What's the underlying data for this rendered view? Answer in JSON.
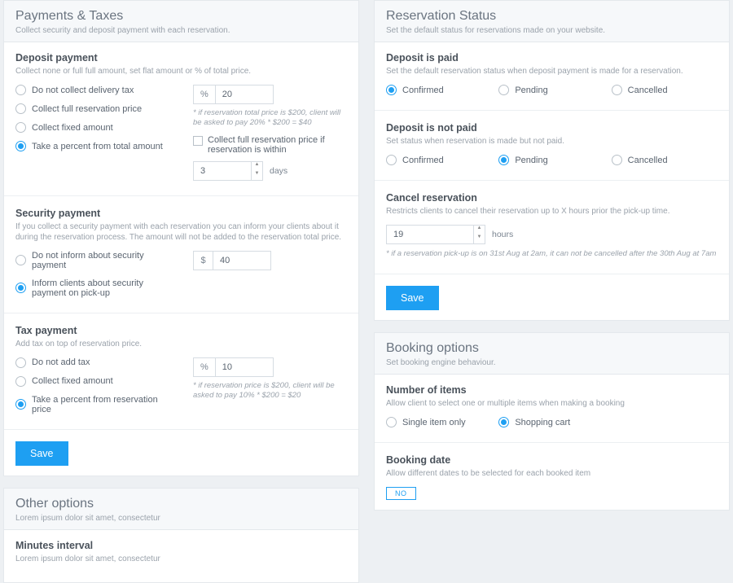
{
  "payments": {
    "title": "Payments & Taxes",
    "subtitle": "Collect security and deposit payment with each reservation.",
    "deposit": {
      "heading": "Deposit payment",
      "sub": "Collect none or full full amount, set flat amount or % of total price.",
      "opts": [
        "Do not collect delivery tax",
        "Collect full reservation price",
        "Collect fixed amount",
        "Take a percent from total amount"
      ],
      "unit": "%",
      "value": "20",
      "hint": "* if reservation total price is $200, client will be asked to pay 20% * $200 = $40",
      "chk": "Collect full reservation price if reservation is within",
      "days_value": "3",
      "days_label": "days"
    },
    "security": {
      "heading": "Security payment",
      "sub": "If you collect a security payment with each reservation you can inform your clients about it during the reservation process. The amount will not be added to the reservation total price.",
      "opts": [
        "Do not inform about security payment",
        "Inform clients about security payment on pick-up"
      ],
      "unit": "$",
      "value": "40"
    },
    "tax": {
      "heading": "Tax payment",
      "sub": "Add tax on top of reservation price.",
      "opts": [
        "Do not add tax",
        "Collect fixed amount",
        "Take a percent from reservation price"
      ],
      "unit": "%",
      "value": "10",
      "hint": "* if reservation price is $200, client will be asked to pay 10% * $200 = $20"
    },
    "save": "Save"
  },
  "other": {
    "title": "Other options",
    "subtitle": "Lorem ipsum dolor sit amet, consectetur",
    "minutes": {
      "heading": "Minutes interval",
      "sub": "Lorem ipsum dolor sit amet, consectetur"
    }
  },
  "status": {
    "title": "Reservation Status",
    "subtitle": "Set the default status for reservations made on your website.",
    "paid": {
      "heading": "Deposit is paid",
      "sub": "Set the default reservation status when deposit payment is made for a reservation."
    },
    "notpaid": {
      "heading": "Deposit is not paid",
      "sub": "Set status when reservation is made but not paid."
    },
    "opts": [
      "Confirmed",
      "Pending",
      "Cancelled"
    ],
    "cancel": {
      "heading": "Cancel reservation",
      "sub": "Restricts clients to cancel their reservation up to X hours prior the pick-up time.",
      "value": "19",
      "unit": "hours",
      "hint": "* if a reservation pick-up is on 31st Aug at 2am, it can not be cancelled after the 30th Aug at 7am"
    },
    "save": "Save"
  },
  "booking": {
    "title": "Booking options",
    "subtitle": "Set booking engine behaviour.",
    "items": {
      "heading": "Number of items",
      "sub": "Allow client to select one or multiple items when making a booking",
      "opts": [
        "Single item only",
        "Shopping cart"
      ]
    },
    "date": {
      "heading": "Booking date",
      "sub": "Allow different dates to be selected for each booked item",
      "toggle": "NO"
    }
  }
}
